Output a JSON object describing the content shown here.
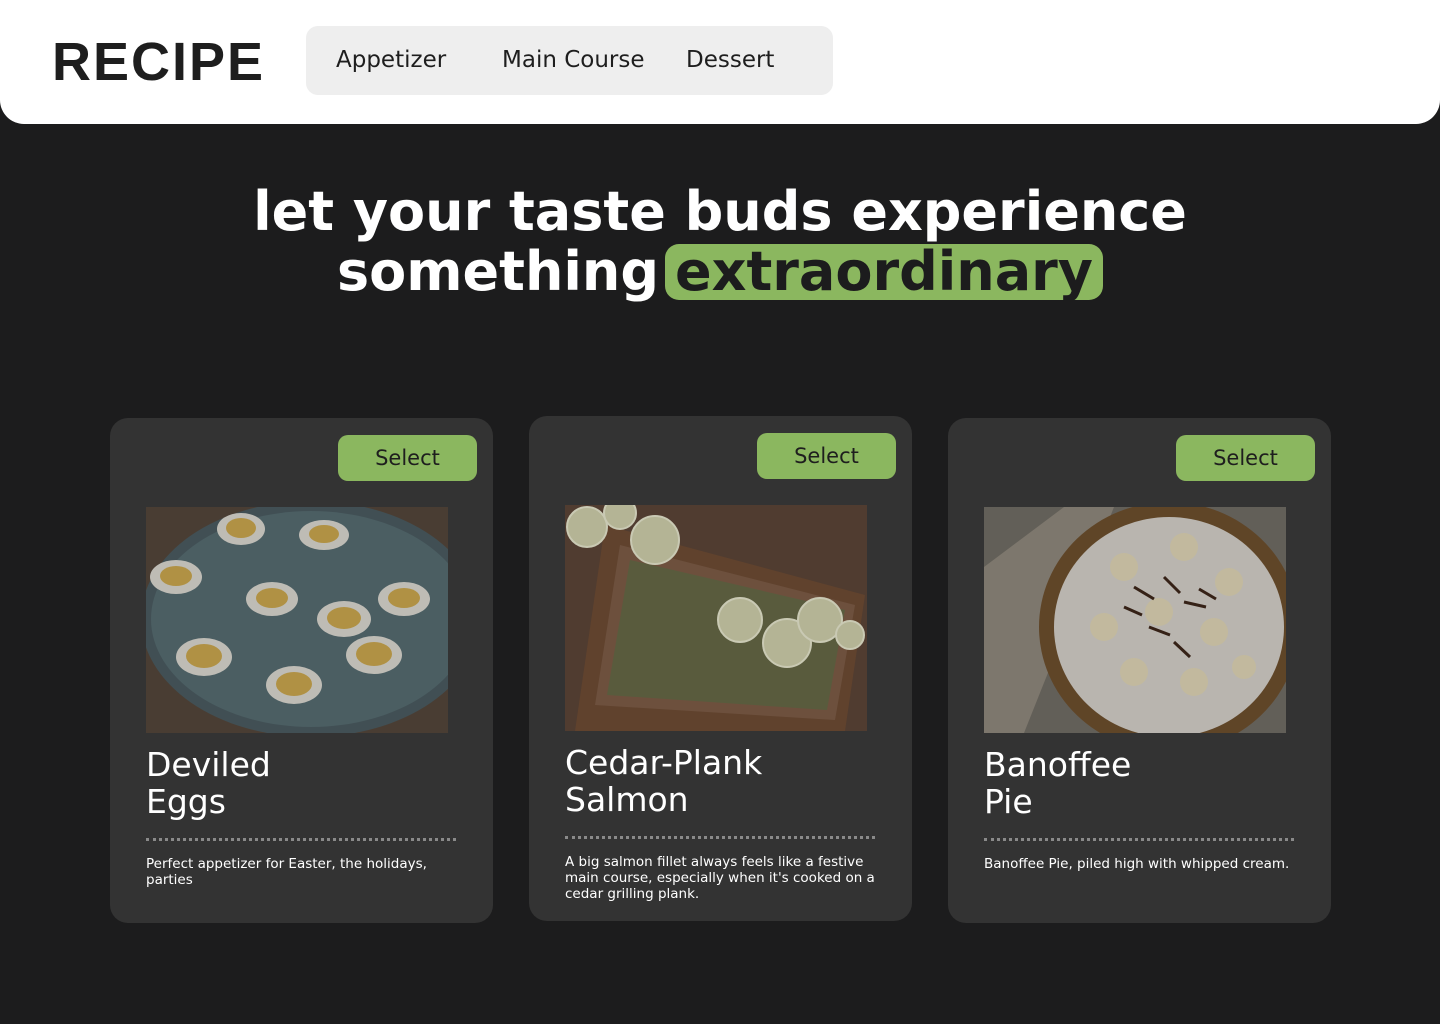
{
  "header": {
    "logo": "RECIPE",
    "nav": [
      "Appetizer",
      "Main Course",
      "Dessert"
    ]
  },
  "hero": {
    "line1": "let your taste buds experience",
    "line2_prefix": "something",
    "highlight": "extraordinary"
  },
  "cards": [
    {
      "button": "Select",
      "title_line1": "Deviled",
      "title_line2": "Eggs",
      "description": "Perfect appetizer for Easter, the holidays, parties",
      "image": "deviled-eggs-photo"
    },
    {
      "button": "Select",
      "title_line1": "Cedar-Plank",
      "title_line2": "Salmon",
      "description": "A big salmon fillet always feels like a festive main course, especially when it's cooked on a cedar grilling plank.",
      "image": "cedar-plank-salmon-photo"
    },
    {
      "button": "Select",
      "title_line1": "Banoffee",
      "title_line2": "Pie",
      "description": "Banoffee Pie, piled high with whipped cream.",
      "image": "banoffee-pie-photo"
    }
  ],
  "colors": {
    "accent": "#8bb75f",
    "background": "#1c1c1d",
    "card": "#333333"
  }
}
